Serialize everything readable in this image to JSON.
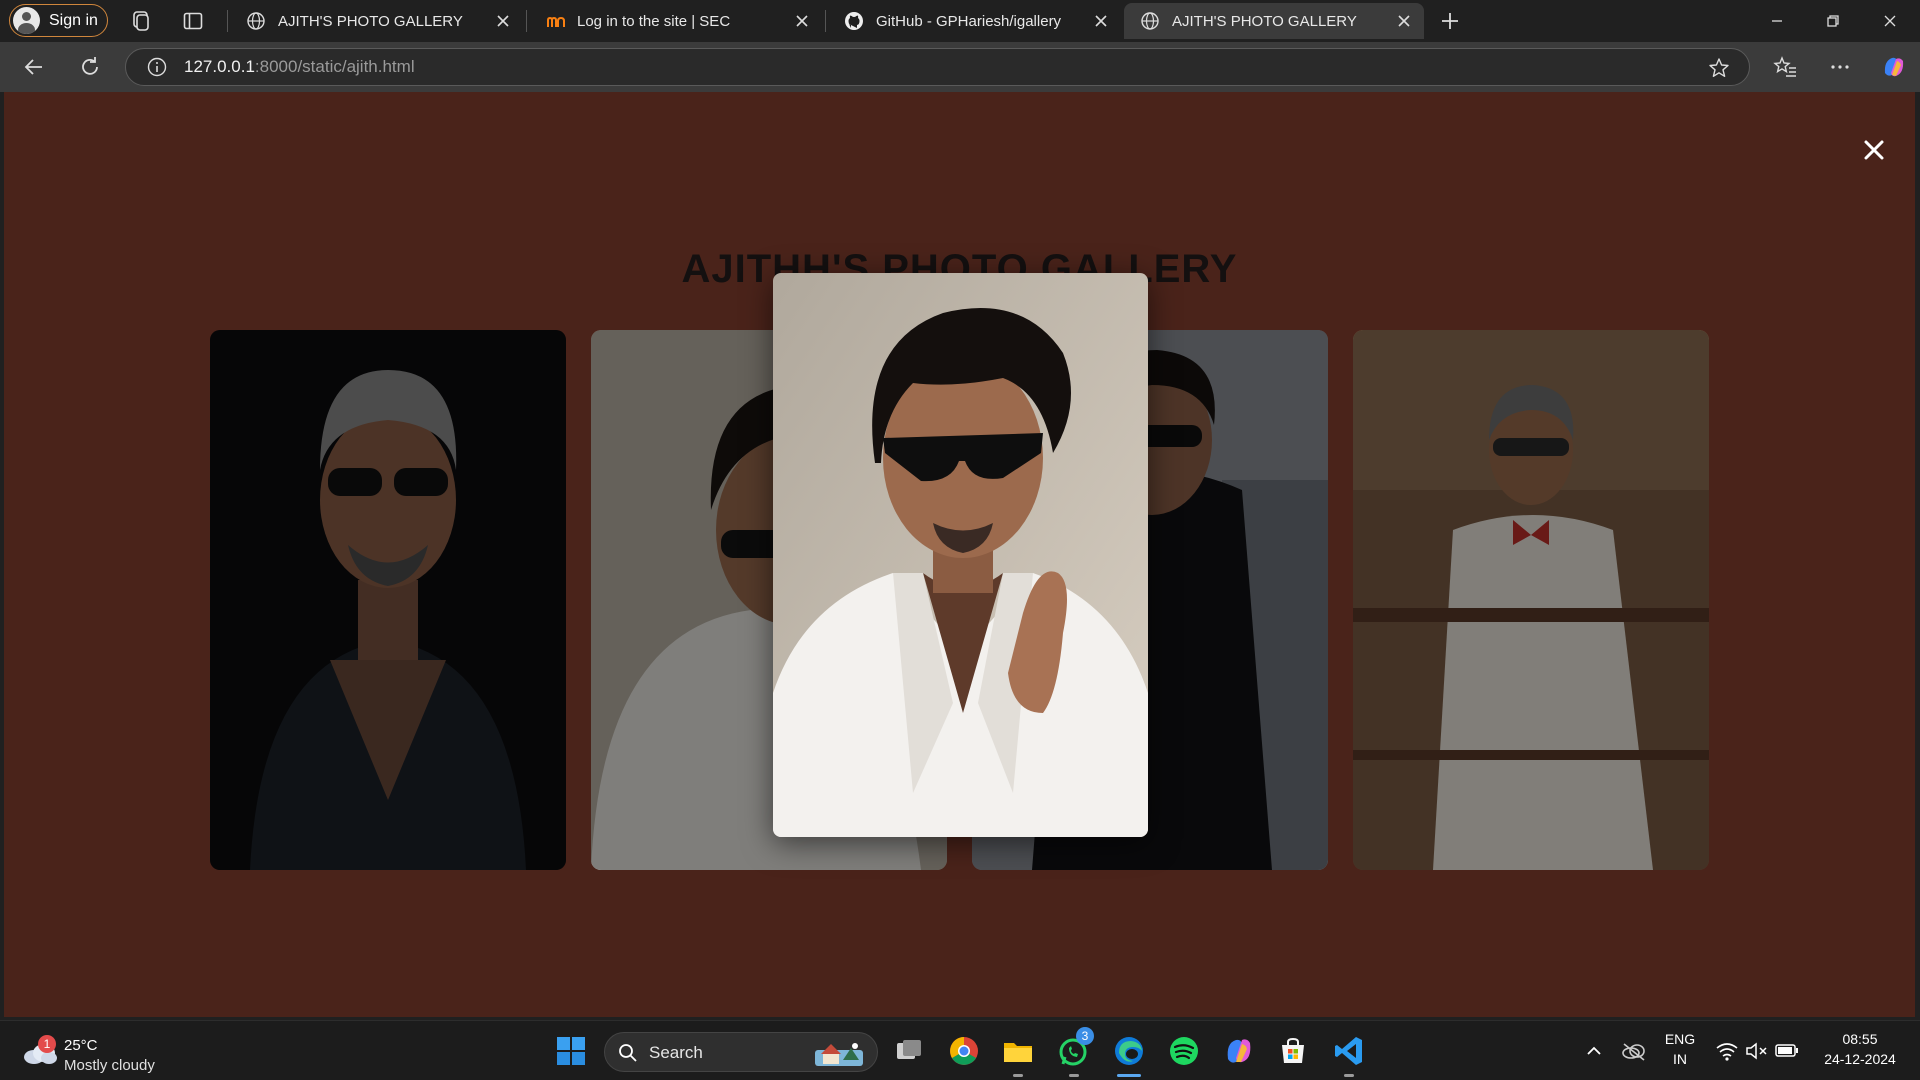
{
  "browser": {
    "signin_label": "Sign in",
    "tabs": [
      {
        "title": "AJITH'S PHOTO GALLERY",
        "active": false
      },
      {
        "title": "Log in to the site | SEC",
        "active": false
      },
      {
        "title": "GitHub - GPHariesh/igallery",
        "active": false
      },
      {
        "title": "AJITH'S PHOTO GALLERY",
        "active": true
      }
    ],
    "url_host": "127.0.0.1",
    "url_rest": ":8000/static/ajith.html"
  },
  "page": {
    "title": "AJITHH'S PHOTO GALLERY",
    "background": "#4a231a",
    "photos": [
      {
        "subject": "portrait-sunglasses-dark-shirt"
      },
      {
        "subject": "portrait-white-jacket"
      },
      {
        "subject": "portrait-black-suit"
      },
      {
        "subject": "portrait-white-suit-bowtie"
      }
    ],
    "lightbox": {
      "open": true,
      "photo_index": 1
    }
  },
  "taskbar": {
    "weather_badge": "1",
    "temperature": "25°C",
    "condition": "Mostly cloudy",
    "search_label": "Search",
    "whatsapp_badge": "3",
    "lang_primary": "ENG",
    "lang_secondary": "IN",
    "time": "08:55",
    "date": "24-12-2024"
  }
}
